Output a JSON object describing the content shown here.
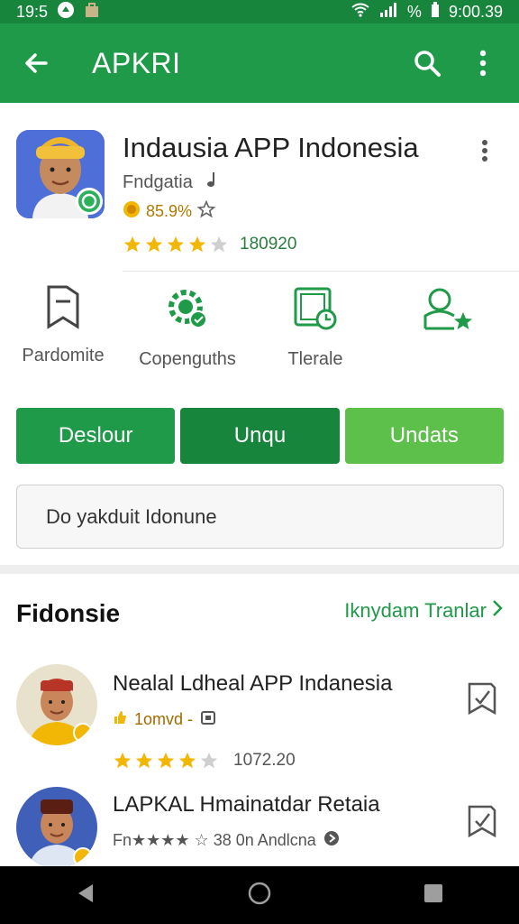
{
  "status_bar": {
    "left_time": "19:5",
    "right_signal": "%",
    "clock": "9:00.39"
  },
  "app_bar": {
    "title": "APKRI"
  },
  "app": {
    "title": "Indausia APP Indonesia",
    "developer": "Fndgatia",
    "percent": "85.9%",
    "rating_count": "180920",
    "rating_value": 4
  },
  "features": [
    {
      "label": "Pardomite"
    },
    {
      "label": "Copenguths"
    },
    {
      "label": "Tlerale"
    }
  ],
  "actions": {
    "btn1": "Deslour",
    "btn2": "Unqu",
    "btn3": "Undats"
  },
  "search": {
    "text": "Do yakduit Idonune"
  },
  "section": {
    "title": "Fidonsie",
    "link": "Iknydam Tranlar"
  },
  "list": [
    {
      "title": "Nealal Ldheal APP Indanesia",
      "sub": "1omvd -",
      "rating": "1072.20",
      "stars": 4
    },
    {
      "title": "LAPKAL Hmainatdar Retaia",
      "sub": "Fn★★★★ ☆ 38 0n Andlcna",
      "rating": "",
      "stars": 4
    }
  ],
  "colors": {
    "primary": "#1f9a48",
    "primary_dark": "#17853c",
    "accent_light": "#5cc04a",
    "star": "#f2b705"
  }
}
